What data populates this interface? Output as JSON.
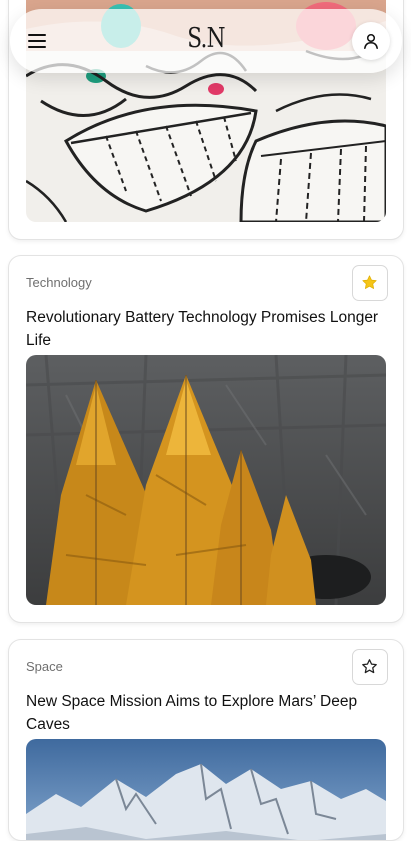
{
  "header": {
    "logo_text": "S.N",
    "menu_icon": "hamburger-menu-icon",
    "profile_icon": "user-icon"
  },
  "articles": [
    {
      "category": "",
      "title": "",
      "favorited": false,
      "image_subject": "coloring-page-with-markers"
    },
    {
      "category": "Technology",
      "title": "Revolutionary Battery Technology Promises Longer Life",
      "favorited": true,
      "star_color": "#f5c518",
      "image_subject": "golden-larch-trees-against-rock-face"
    },
    {
      "category": "Space",
      "title": "New Space Mission Aims to Explore Mars’ Deep Caves",
      "favorited": false,
      "image_subject": "snowy-mountain-range-under-blue-sky"
    }
  ]
}
